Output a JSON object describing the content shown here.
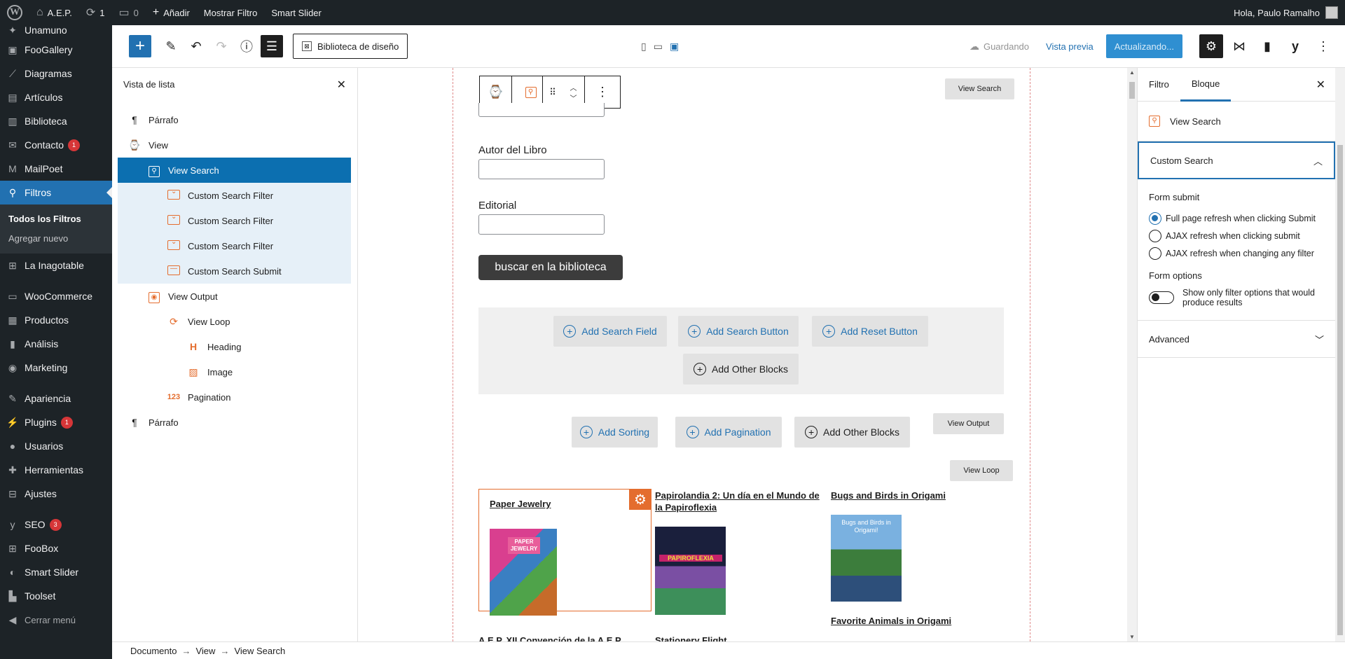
{
  "admin_bar": {
    "site_name": "A.E.P.",
    "updates_count": "1",
    "comments_count": "0",
    "add_label": "Añadir",
    "show_filter": "Mostrar Filtro",
    "smart_slider": "Smart Slider",
    "greeting": "Hola, Paulo Ramalho"
  },
  "admin_menu": {
    "items": [
      {
        "label": "Unamuno",
        "icon": "pin-icon"
      },
      {
        "label": "FooGallery",
        "icon": "gallery-icon"
      },
      {
        "label": "Diagramas",
        "icon": "chart-icon"
      },
      {
        "label": "Artículos",
        "icon": "articles-icon"
      },
      {
        "label": "Biblioteca",
        "icon": "library-icon"
      },
      {
        "label": "Contacto",
        "icon": "mail-icon",
        "badge": "1"
      },
      {
        "label": "MailPoet",
        "icon": "mailpoet-icon"
      },
      {
        "label": "Filtros",
        "icon": "search-icon",
        "current": true
      },
      {
        "label": "La Inagotable",
        "icon": "grid-icon"
      },
      {
        "label": "WooCommerce",
        "icon": "woo-icon"
      },
      {
        "label": "Productos",
        "icon": "products-icon"
      },
      {
        "label": "Análisis",
        "icon": "bar-chart-icon"
      },
      {
        "label": "Marketing",
        "icon": "megaphone-icon"
      },
      {
        "label": "Apariencia",
        "icon": "brush-icon"
      },
      {
        "label": "Plugins",
        "icon": "plug-icon",
        "badge": "1"
      },
      {
        "label": "Usuarios",
        "icon": "user-icon"
      },
      {
        "label": "Herramientas",
        "icon": "wrench-icon"
      },
      {
        "label": "Ajustes",
        "icon": "sliders-icon"
      },
      {
        "label": "SEO",
        "icon": "yoast-icon",
        "badge": "3"
      },
      {
        "label": "FooBox",
        "icon": "grid-icon"
      },
      {
        "label": "Smart Slider",
        "icon": "slider-icon"
      },
      {
        "label": "Toolset",
        "icon": "toolset-icon"
      },
      {
        "label": "Cerrar menú",
        "icon": "collapse-icon"
      }
    ],
    "submenu": [
      "Todos los Filtros",
      "Agregar nuevo"
    ]
  },
  "editor_header": {
    "design_library": "Biblioteca de diseño",
    "saving": "Guardando",
    "preview": "Vista previa",
    "update": "Actualizando..."
  },
  "list_view": {
    "title": "Vista de lista",
    "rows": [
      {
        "label": "Párrafo",
        "icon": "paragraph-icon"
      },
      {
        "label": "View",
        "icon": "view-icon"
      },
      {
        "label": "View Search",
        "icon": "view-search-icon"
      },
      {
        "label": "Custom Search Filter",
        "icon": "filter-icon"
      },
      {
        "label": "Custom Search Filter",
        "icon": "filter-icon"
      },
      {
        "label": "Custom Search Filter",
        "icon": "filter-icon"
      },
      {
        "label": "Custom Search Submit",
        "icon": "submit-icon"
      },
      {
        "label": "View Output",
        "icon": "view-output-icon"
      },
      {
        "label": "View Loop",
        "icon": "loop-icon"
      },
      {
        "label": "Heading",
        "icon": "heading-icon"
      },
      {
        "label": "Image",
        "icon": "image-icon"
      },
      {
        "label": "Pagination",
        "icon": "pagination-icon"
      },
      {
        "label": "Párrafo",
        "icon": "paragraph-icon"
      }
    ]
  },
  "canvas": {
    "view_search_tag": "View Search",
    "field_author": "Autor del Libro",
    "field_publisher": "Editorial",
    "search_button": "buscar en la biblioteca",
    "add_search_field": "Add Search Field",
    "add_search_button": "Add Search Button",
    "add_reset_button": "Add Reset Button",
    "add_other_blocks": "Add Other Blocks",
    "add_sorting": "Add Sorting",
    "add_pagination": "Add Pagination",
    "view_output_tag": "View Output",
    "view_loop_tag": "View Loop",
    "books": [
      {
        "title": "Paper Jewelry",
        "cover_title": "PAPER JEWELRY"
      },
      {
        "title": "Papirolandia 2: Un día en el Mundo de la Papiroflexia",
        "cover_title": "PAPIROFLEXIA"
      },
      {
        "title": "Bugs and Birds in Origami",
        "cover_title": "Bugs and Birds in Origami!"
      },
      {
        "title": "Favorite Animals in Origami"
      },
      {
        "title": "A.E.P. XII Convención de la A.E.P."
      },
      {
        "title": "Stationery Flight"
      }
    ]
  },
  "sidebar": {
    "tab_filter": "Filtro",
    "tab_block": "Bloque",
    "block_name": "View Search",
    "section_title": "Custom Search",
    "form_submit_label": "Form submit",
    "radio_options": [
      "Full page refresh when clicking Submit",
      "AJAX refresh when clicking submit",
      "AJAX refresh when changing any filter"
    ],
    "form_options_label": "Form options",
    "toggle_label": "Show only filter options that would produce results",
    "advanced": "Advanced"
  },
  "breadcrumb": [
    "Documento",
    "View",
    "View Search"
  ]
}
